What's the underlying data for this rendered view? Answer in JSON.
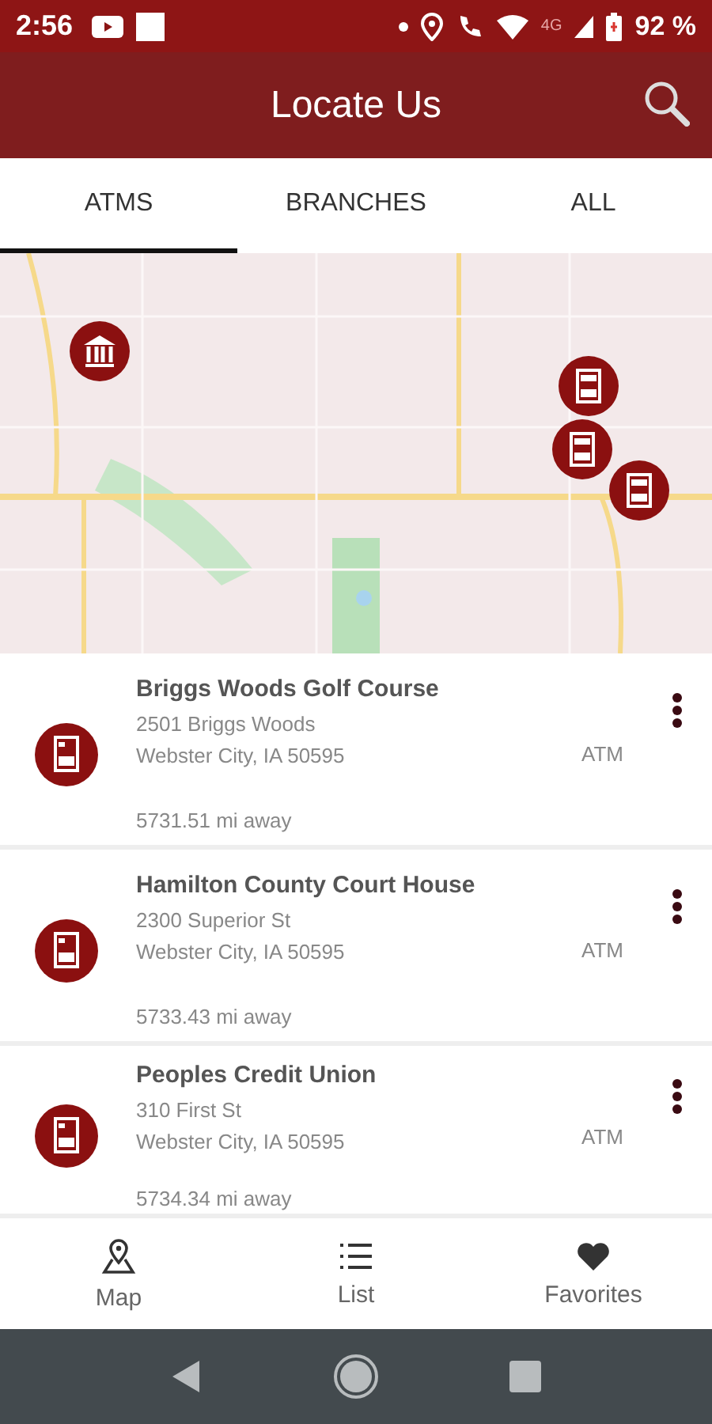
{
  "status_bar": {
    "time": "2:56",
    "network": "4G",
    "battery": "92 %"
  },
  "header": {
    "title": "Locate Us"
  },
  "tabs": [
    {
      "label": "ATMS",
      "selected": true
    },
    {
      "label": "BRANCHES",
      "selected": false
    },
    {
      "label": "ALL",
      "selected": false
    }
  ],
  "map": {
    "kind": "picture",
    "markers": [
      {
        "kind": "bank"
      },
      {
        "kind": "atm"
      },
      {
        "kind": "atm"
      },
      {
        "kind": "atm"
      }
    ]
  },
  "locations": [
    {
      "name": "Briggs Woods Golf Course",
      "address_1": "2501 Briggs Woods",
      "address_2": "Webster City, IA 50595",
      "type": "ATM",
      "distance": "5731.51 mi away"
    },
    {
      "name": "Hamilton County Court House",
      "address_1": "2300 Superior St",
      "address_2": "Webster City, IA 50595",
      "type": "ATM",
      "distance": "5733.43 mi away"
    },
    {
      "name": "Peoples Credit Union",
      "address_1": "310 First St",
      "address_2": "Webster City, IA 50595",
      "type": "ATM",
      "distance": "5734.34 mi away"
    }
  ],
  "bottom_nav": [
    {
      "label": "Map",
      "kind": "map"
    },
    {
      "label": "List",
      "kind": "list"
    },
    {
      "label": "Favorites",
      "kind": "favorites"
    }
  ]
}
